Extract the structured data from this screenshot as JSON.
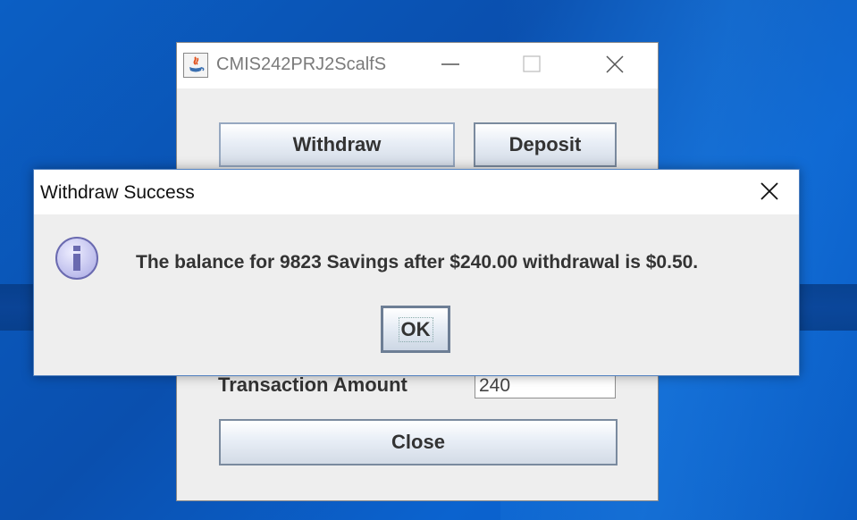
{
  "main_window": {
    "title": "CMIS242PRJ2ScalfS",
    "buttons": {
      "withdraw": "Withdraw",
      "deposit": "Deposit",
      "close": "Close"
    },
    "transaction_amount_label": "Transaction Amount",
    "transaction_amount_value": "240"
  },
  "dialog": {
    "title": "Withdraw Success",
    "message": "The balance for 9823 Savings after $240.00 withdrawal is $0.50.",
    "ok_label": "OK"
  },
  "icons": {
    "app": "java-app-icon",
    "minimize": "minimize-icon",
    "maximize": "maximize-icon",
    "close": "close-icon",
    "info": "info-icon"
  },
  "colors": {
    "desktop": "#0b5fc4",
    "dialog_border": "#4e7fbf",
    "info_icon_fill": "#c8c8f0"
  }
}
